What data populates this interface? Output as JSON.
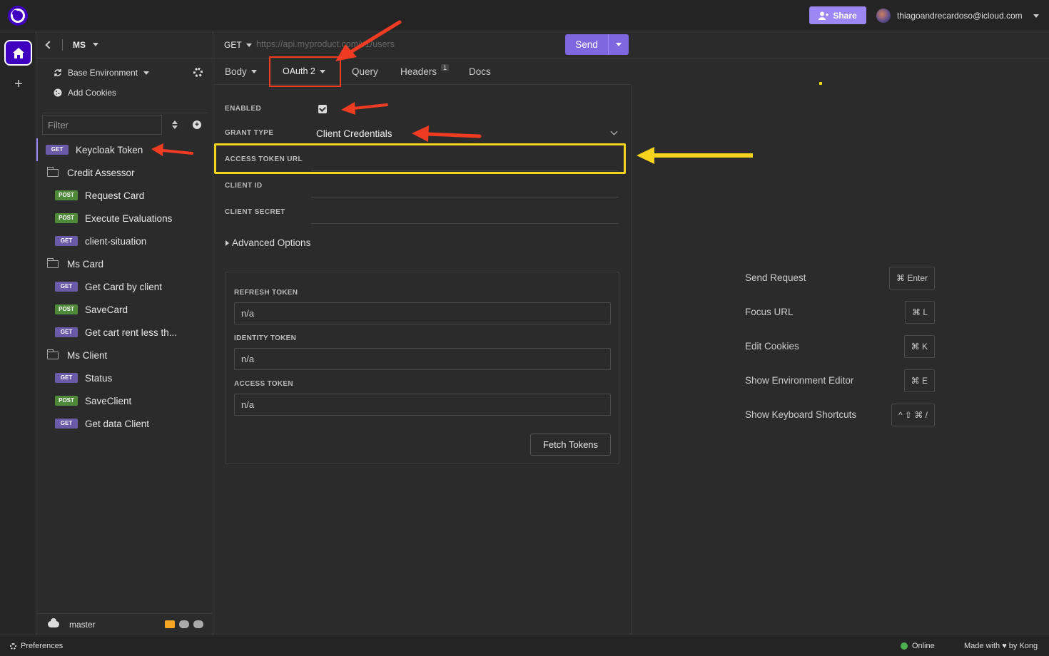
{
  "topbar": {
    "share_label": "Share",
    "user_email": "thiagoandrecardoso@icloud.com"
  },
  "sidebar": {
    "workspace": "MS",
    "environment": "Base Environment",
    "add_cookies": "Add Cookies",
    "filter_placeholder": "Filter",
    "items": [
      {
        "type": "request",
        "method": "GET",
        "label": "Keycloak Token",
        "selected": true
      },
      {
        "type": "folder",
        "label": "Credit Assessor"
      },
      {
        "type": "request",
        "method": "POST",
        "label": "Request Card"
      },
      {
        "type": "request",
        "method": "POST",
        "label": "Execute Evaluations"
      },
      {
        "type": "request",
        "method": "GET",
        "label": "client-situation"
      },
      {
        "type": "folder",
        "label": "Ms Card"
      },
      {
        "type": "request",
        "method": "GET",
        "label": "Get Card by client"
      },
      {
        "type": "request",
        "method": "POST",
        "label": "SaveCard"
      },
      {
        "type": "request",
        "method": "GET",
        "label": "Get cart rent less th..."
      },
      {
        "type": "folder",
        "label": "Ms Client"
      },
      {
        "type": "request",
        "method": "GET",
        "label": "Status"
      },
      {
        "type": "request",
        "method": "POST",
        "label": "SaveClient"
      },
      {
        "type": "request",
        "method": "GET",
        "label": "Get data Client"
      }
    ],
    "branch": "master"
  },
  "request": {
    "method": "GET",
    "url_placeholder": "https://api.myproduct.com/v1/users",
    "send_label": "Send",
    "tabs": {
      "body": "Body",
      "auth": "OAuth 2",
      "query": "Query",
      "headers": "Headers",
      "headers_count": "1",
      "docs": "Docs"
    }
  },
  "auth": {
    "enabled_label": "ENABLED",
    "enabled": true,
    "grant_type_label": "GRANT TYPE",
    "grant_type_value": "Client Credentials",
    "access_token_url_label": "ACCESS TOKEN URL",
    "client_id_label": "CLIENT ID",
    "client_secret_label": "CLIENT SECRET",
    "advanced_options": "Advanced Options",
    "refresh_token_label": "REFRESH TOKEN",
    "refresh_token_value": "n/a",
    "identity_token_label": "IDENTITY TOKEN",
    "identity_token_value": "n/a",
    "access_token_label": "ACCESS TOKEN",
    "access_token_value": "n/a",
    "fetch_label": "Fetch Tokens"
  },
  "shortcuts": [
    {
      "label": "Send Request",
      "key": "⌘ Enter"
    },
    {
      "label": "Focus URL",
      "key": "⌘ L"
    },
    {
      "label": "Edit Cookies",
      "key": "⌘ K"
    },
    {
      "label": "Show Environment Editor",
      "key": "⌘ E"
    },
    {
      "label": "Show Keyboard Shortcuts",
      "key": "^ ⇧ ⌘ /"
    }
  ],
  "statusbar": {
    "preferences": "Preferences",
    "online": "Online",
    "made_with_prefix": "Made with",
    "made_with_suffix": "by Kong"
  },
  "colors": {
    "accent": "#7d68e0",
    "annotation_red": "#ee3b22",
    "annotation_yellow": "#f5d21c",
    "get_badge": "#6a5ba8",
    "post_badge": "#4f8a3a"
  }
}
